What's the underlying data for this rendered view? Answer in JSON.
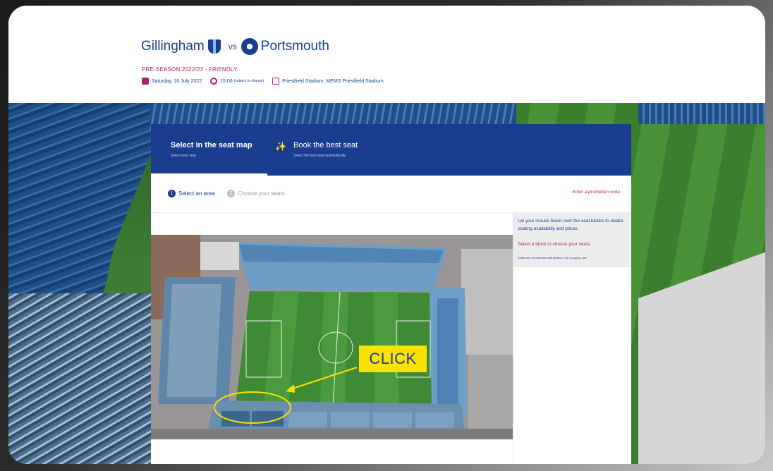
{
  "match": {
    "home_team": "Gillingham",
    "vs": "vs",
    "away_team": "Portsmouth",
    "competition": "PRE-SEASON 2022/23 - FRIENDLY",
    "date": "Saturday, 16 July 2022",
    "time": "15:00",
    "time_note": "(subject to change)",
    "venue": "Priestfield Stadium, MEMS Priestfield Stadium"
  },
  "tabs": [
    {
      "title": "Select in the seat map",
      "subtitle": "Select your seat",
      "active": true
    },
    {
      "title": "Book the best seat",
      "subtitle": "Select the best seat automatically",
      "active": false
    }
  ],
  "steps": [
    {
      "number": "1",
      "label": "Select an area",
      "active": true
    },
    {
      "number": "2",
      "label": "Choose your seats",
      "active": false
    }
  ],
  "promo_link": "Enter a promotion code",
  "info": {
    "hover_text": "Let your mouse hover over the seat blocks to obtain seating availability and prices.",
    "select_text": "Select a block to choose your seats.",
    "note": "Seats are not reserved until added to the shopping cart."
  },
  "annotation": {
    "label": "CLICK",
    "color": "#fbe100"
  },
  "colors": {
    "brand_blue": "#1b3d8f",
    "accent_magenta": "#b01d74",
    "pitch_green": "#3f8a35"
  }
}
